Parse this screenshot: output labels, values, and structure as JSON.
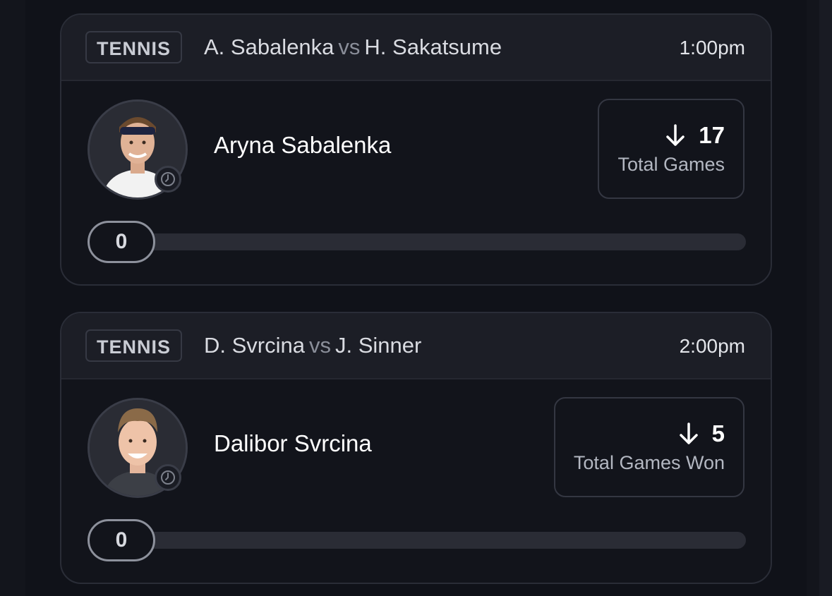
{
  "cards": [
    {
      "sport": "TENNIS",
      "player1": "A. Sabalenka",
      "vs": "vs",
      "player2": "H. Sakatsume",
      "time": "1:00pm",
      "player_name": "Aryna Sabalenka",
      "direction_icon": "arrow-down-icon",
      "stat_value": "17",
      "stat_label": "Total Games",
      "progress_value": "0",
      "progress_fraction": 0
    },
    {
      "sport": "TENNIS",
      "player1": "D. Svrcina",
      "vs": "vs",
      "player2": "J. Sinner",
      "time": "2:00pm",
      "player_name": "Dalibor Svrcina",
      "direction_icon": "arrow-down-icon",
      "stat_value": "5",
      "stat_label": "Total Games Won",
      "progress_value": "0",
      "progress_fraction": 0
    }
  ],
  "colors": {
    "background": "#13151c",
    "card_header": "#1c1e26",
    "card_body": "#12141b",
    "text_primary": "#ffffff",
    "text_secondary": "#b3b7c1"
  }
}
